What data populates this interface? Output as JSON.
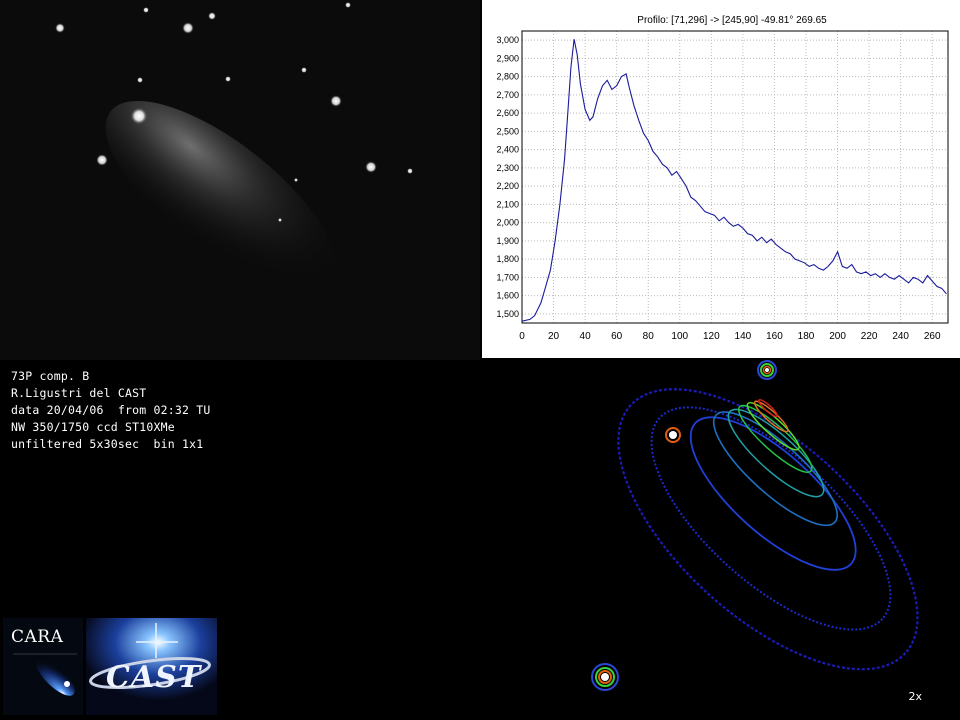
{
  "info": {
    "lines": [
      "73P comp. B",
      "R.Ligustri del CAST",
      "data 20/04/06  from 02:32 TU",
      "NW 350/1750 ccd ST10XMe",
      "unfiltered 5x30sec  bin 1x1"
    ]
  },
  "logos": {
    "cara": "CARA",
    "cast": "CAST"
  },
  "contour": {
    "zoom_label": "2x"
  },
  "chart_data": {
    "type": "line",
    "title": "Profilo: [71,296] -> [245,90] -49.81° 269.65",
    "xlim": [
      0,
      270
    ],
    "ylim": [
      1450,
      3050
    ],
    "x_ticks": [
      0,
      20,
      40,
      60,
      80,
      100,
      120,
      140,
      160,
      180,
      200,
      220,
      240,
      260
    ],
    "y_ticks": [
      1500,
      1600,
      1700,
      1800,
      1900,
      2000,
      2100,
      2200,
      2300,
      2400,
      2500,
      2600,
      2700,
      2800,
      2900,
      3000
    ],
    "y_tick_labels": [
      "1,500",
      "1,600",
      "1,700",
      "1,800",
      "1,900",
      "2,000",
      "2,100",
      "2,200",
      "2,300",
      "2,400",
      "2,500",
      "2,600",
      "2,700",
      "2,800",
      "2,900",
      "3,000"
    ],
    "grid": true,
    "line_color": "#1a1a9c",
    "points": [
      [
        0,
        1460
      ],
      [
        5,
        1470
      ],
      [
        8,
        1490
      ],
      [
        12,
        1560
      ],
      [
        15,
        1650
      ],
      [
        18,
        1740
      ],
      [
        21,
        1900
      ],
      [
        24,
        2100
      ],
      [
        27,
        2350
      ],
      [
        29,
        2600
      ],
      [
        31,
        2850
      ],
      [
        33,
        3005
      ],
      [
        35,
        2920
      ],
      [
        37,
        2760
      ],
      [
        40,
        2620
      ],
      [
        43,
        2560
      ],
      [
        45,
        2580
      ],
      [
        48,
        2680
      ],
      [
        51,
        2750
      ],
      [
        54,
        2780
      ],
      [
        57,
        2730
      ],
      [
        60,
        2750
      ],
      [
        63,
        2800
      ],
      [
        66,
        2815
      ],
      [
        68,
        2740
      ],
      [
        71,
        2640
      ],
      [
        74,
        2560
      ],
      [
        77,
        2490
      ],
      [
        80,
        2450
      ],
      [
        83,
        2390
      ],
      [
        86,
        2360
      ],
      [
        89,
        2320
      ],
      [
        92,
        2300
      ],
      [
        95,
        2260
      ],
      [
        98,
        2280
      ],
      [
        101,
        2240
      ],
      [
        104,
        2200
      ],
      [
        107,
        2140
      ],
      [
        110,
        2120
      ],
      [
        113,
        2090
      ],
      [
        116,
        2060
      ],
      [
        119,
        2050
      ],
      [
        122,
        2040
      ],
      [
        125,
        2010
      ],
      [
        128,
        2030
      ],
      [
        131,
        2000
      ],
      [
        134,
        1980
      ],
      [
        137,
        1990
      ],
      [
        140,
        1970
      ],
      [
        143,
        1940
      ],
      [
        146,
        1930
      ],
      [
        149,
        1900
      ],
      [
        152,
        1920
      ],
      [
        155,
        1890
      ],
      [
        158,
        1910
      ],
      [
        161,
        1880
      ],
      [
        164,
        1860
      ],
      [
        167,
        1840
      ],
      [
        170,
        1830
      ],
      [
        173,
        1800
      ],
      [
        176,
        1790
      ],
      [
        179,
        1780
      ],
      [
        182,
        1760
      ],
      [
        185,
        1770
      ],
      [
        188,
        1750
      ],
      [
        191,
        1740
      ],
      [
        194,
        1760
      ],
      [
        197,
        1790
      ],
      [
        200,
        1840
      ],
      [
        203,
        1760
      ],
      [
        206,
        1750
      ],
      [
        209,
        1770
      ],
      [
        212,
        1730
      ],
      [
        215,
        1720
      ],
      [
        218,
        1730
      ],
      [
        221,
        1710
      ],
      [
        224,
        1720
      ],
      [
        227,
        1700
      ],
      [
        230,
        1720
      ],
      [
        233,
        1700
      ],
      [
        236,
        1690
      ],
      [
        239,
        1710
      ],
      [
        242,
        1690
      ],
      [
        245,
        1670
      ],
      [
        248,
        1700
      ],
      [
        251,
        1690
      ],
      [
        254,
        1670
      ],
      [
        257,
        1710
      ],
      [
        260,
        1680
      ],
      [
        263,
        1650
      ],
      [
        266,
        1640
      ],
      [
        269,
        1610
      ]
    ]
  }
}
